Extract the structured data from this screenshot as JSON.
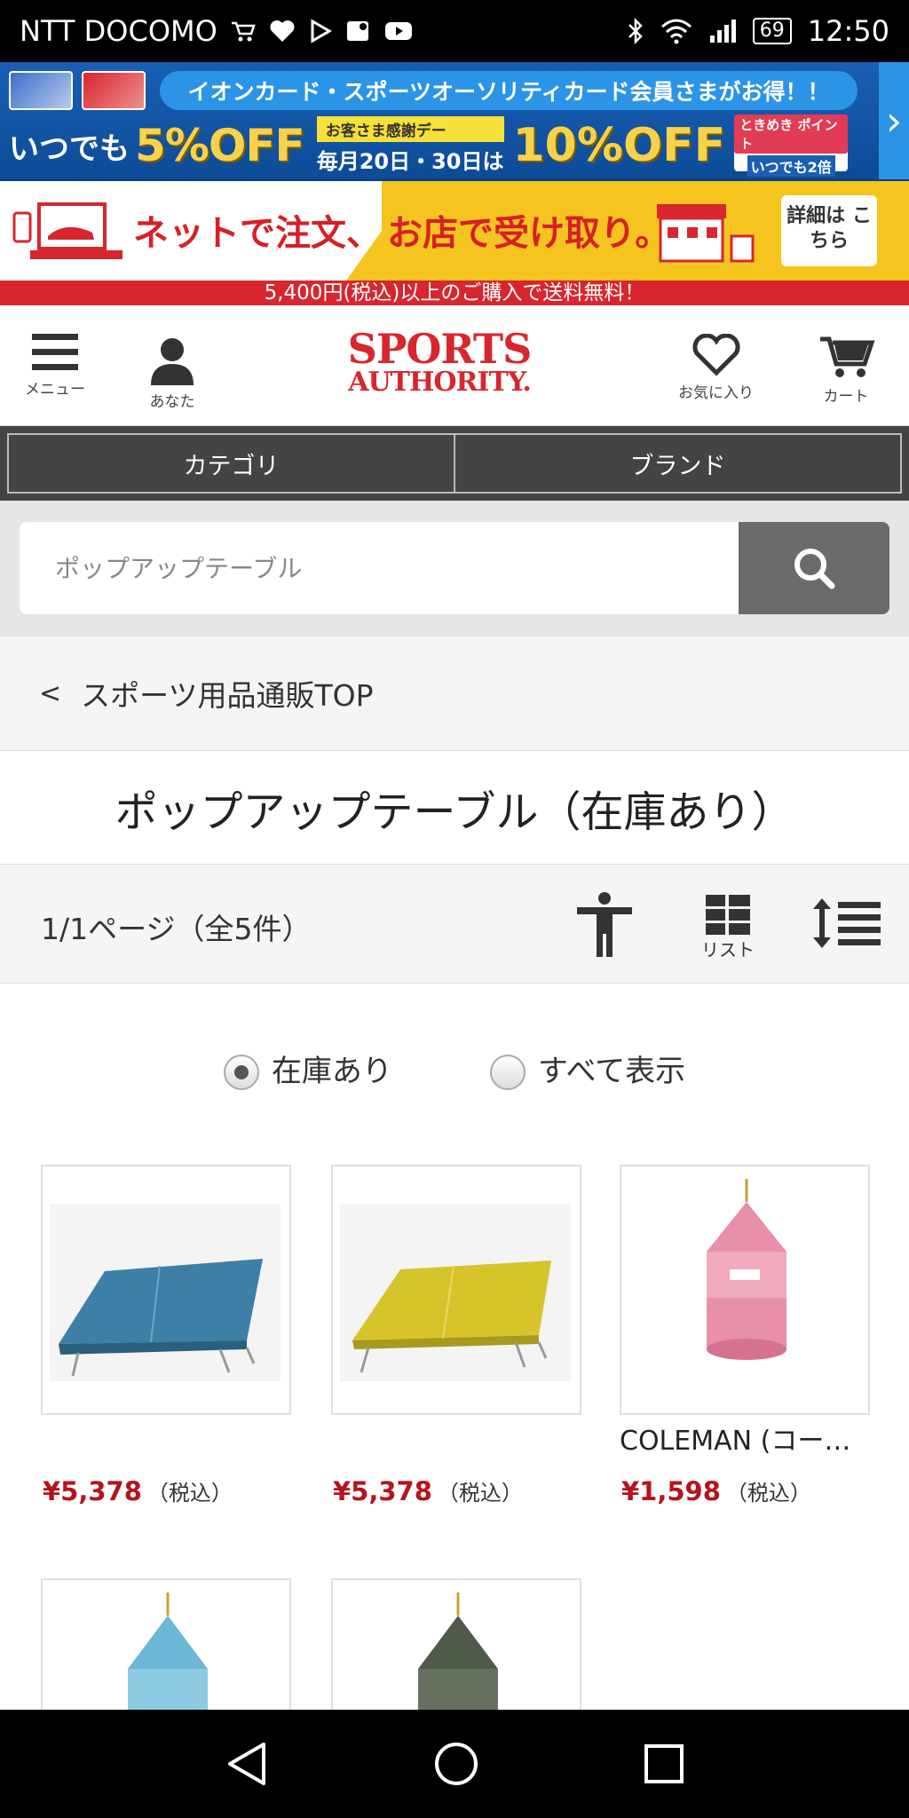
{
  "status_bar": {
    "carrier": "NTT DOCOMO",
    "battery": "69",
    "time": "12:50"
  },
  "promo_banner_1": {
    "headline": "イオンカード・スポーツオーソリティカード会員さまがお得！！",
    "always_prefix": "いつでも",
    "always_off": "5%OFF",
    "thanks_day": "お客さま感謝デー",
    "dates": "毎月20日・30日は",
    "off_10": "10%OFF",
    "tokimeki": "ときめき ポイント",
    "tokimeki_sub": "いつでも2倍"
  },
  "promo_banner_2": {
    "net_order": "ネットで注文、",
    "store_pickup": "お店で受け取り。",
    "details": "詳細は こちら"
  },
  "shipping_notice": "5,400円(税込)以上のご購入で送料無料！",
  "header": {
    "menu_label": "メニュー",
    "account_label": "あなた",
    "logo_line1": "SPORTS",
    "logo_line2": "AUTHORITY.",
    "favorites_label": "お気に入り",
    "cart_label": "カート"
  },
  "nav": {
    "category": "カテゴリ",
    "brand": "ブランド"
  },
  "search": {
    "placeholder": "ポップアップテーブル"
  },
  "breadcrumb": {
    "chevron": "<",
    "label": "スポーツ用品通販TOP"
  },
  "page_title": "ポップアップテーブル（在庫あり）",
  "toolbar": {
    "count": "1/1ページ（全5件）",
    "list_label": "リスト"
  },
  "filters": {
    "in_stock": "在庫あり",
    "show_all": "すべて表示",
    "selected": "in_stock"
  },
  "products": [
    {
      "name": "",
      "price": "¥5,378",
      "tax": "（税込）",
      "color": "#3d7fa6"
    },
    {
      "name": "",
      "price": "¥5,378",
      "tax": "（税込）",
      "color": "#d7c42a"
    },
    {
      "name": "COLEMAN (コー…",
      "price": "¥1,598",
      "tax": "（税込）",
      "color": "#e88fa9"
    },
    {
      "name": "",
      "price": "",
      "tax": "",
      "color": "#6cb7d6"
    },
    {
      "name": "",
      "price": "",
      "tax": "",
      "color": "#4f5a4a"
    }
  ]
}
